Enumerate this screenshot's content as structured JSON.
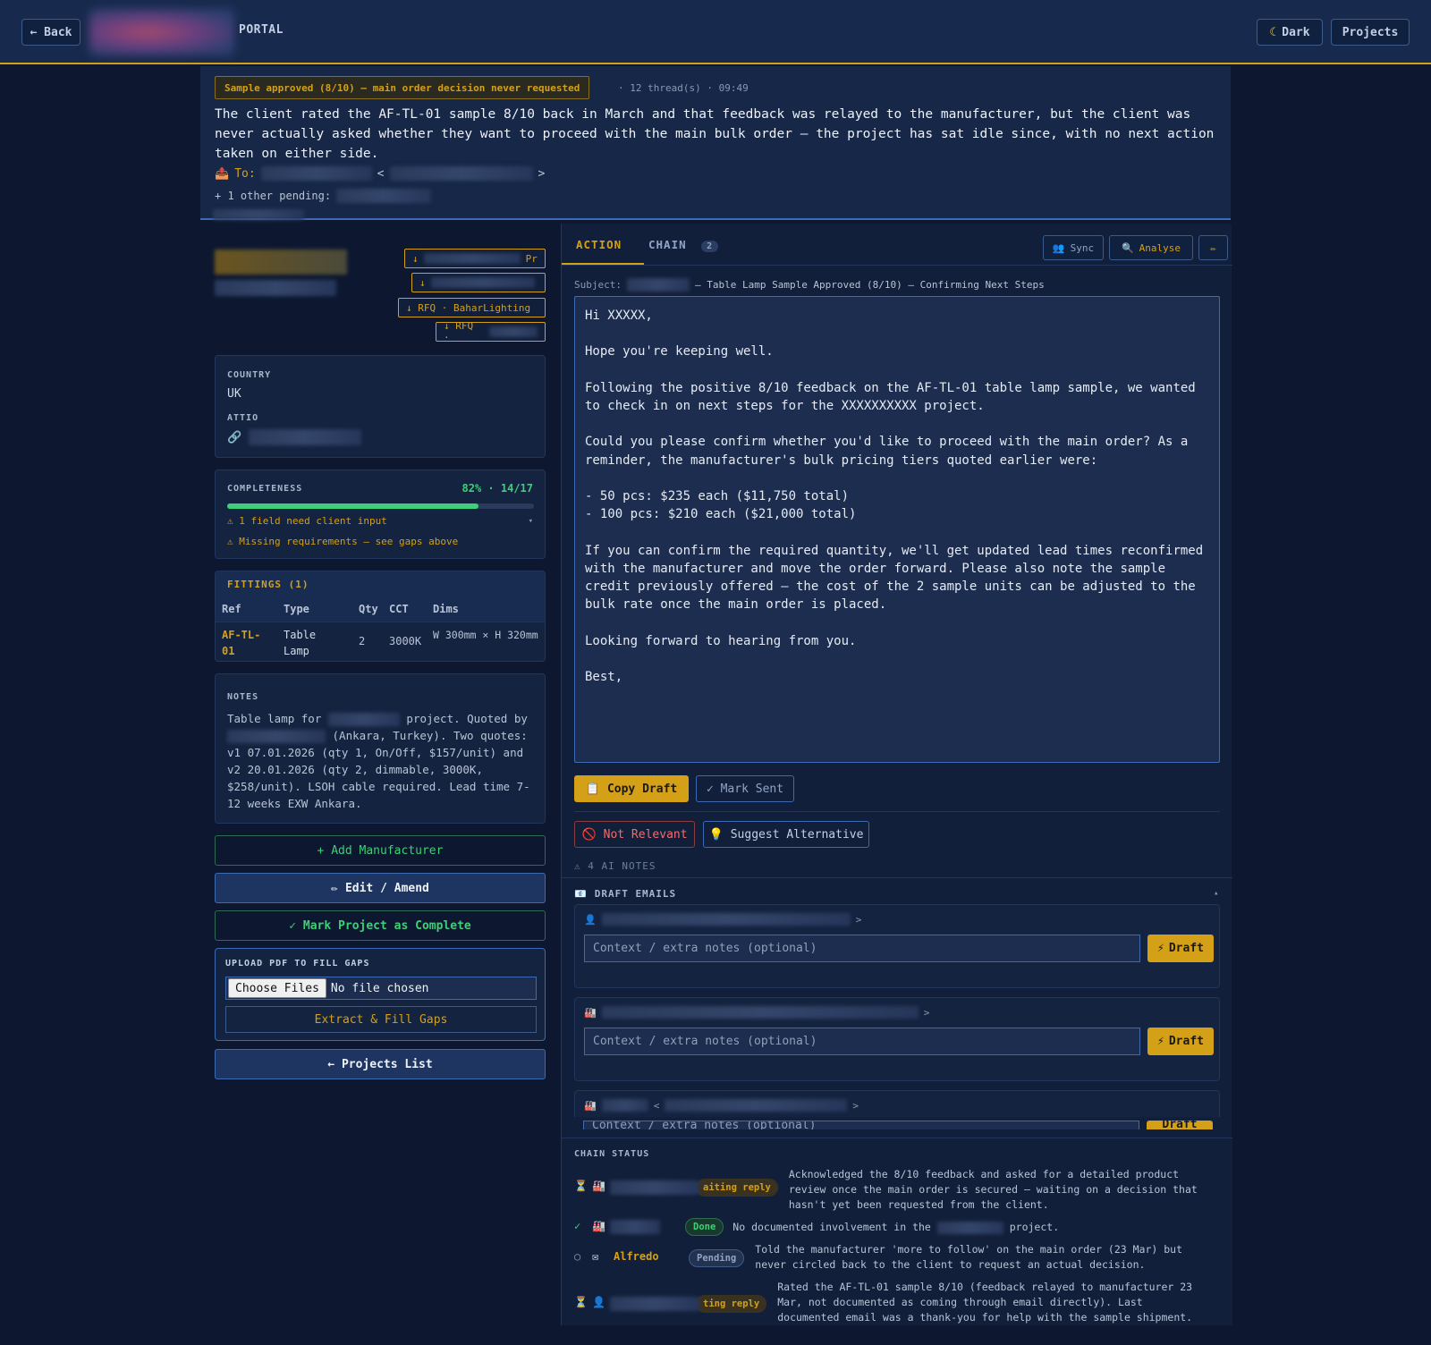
{
  "header": {
    "back_label": "← Back",
    "portal_label": "PORTAL",
    "theme_label": "Dark",
    "projects_label": "Projects"
  },
  "banner": {
    "alert": "Sample approved (8/10) — main order decision never requested",
    "meta": "· 12 thread(s) · 09:49",
    "summary": "The client rated the AF-TL-01 sample 8/10 back in March and that feedback was relayed to the manufacturer, but the client was never actually asked whether they want to proceed with the main bulk order — the project has sat idle since, with no next action taken on either side.",
    "to_label": "To:",
    "other_pending": "+ 1 other pending:"
  },
  "left": {
    "rfq_tags": [
      "↓",
      "Pr",
      "↓",
      "↓ RFQ · BaharLighting",
      "↓ RFQ ·"
    ],
    "country_label": "COUNTRY",
    "country_value": "UK",
    "attio_label": "ATTIO",
    "completeness_label": "COMPLETENESS",
    "completeness_value": "82% · 14/17",
    "completeness_fraction": 0.82,
    "warn_field": "⚠ 1 field need client input",
    "warn_missing": "⚠ Missing requirements — see gaps above",
    "fittings_title": "FITTINGS (1)",
    "fittings_headers": [
      "Ref",
      "Type",
      "Qty",
      "CCT",
      "Dims"
    ],
    "fittings_rows": [
      {
        "ref": "AF-TL-01",
        "type": "Table Lamp",
        "qty": "2",
        "cct": "3000K",
        "dims": "W 300mm × H 320mm"
      }
    ],
    "notes_label": "NOTES",
    "notes_p1": "Table lamp for",
    "notes_p2": "project. Quoted by",
    "notes_p3": "(Ankara, Turkey). Two quotes: v1 07.01.2026 (qty 1, On/Off, $157/unit) and v2 20.01.2026 (qty 2, dimmable, 3000K, $258/unit). LSOH cable required. Lead time 7-12 weeks EXW Ankara.",
    "add_manufacturer": "+ Add Manufacturer",
    "edit_amend": "Edit / Amend",
    "mark_complete": "✓ Mark Project as Complete",
    "upload_label": "UPLOAD PDF TO FILL GAPS",
    "choose_files": "Choose Files",
    "no_file": "No file chosen",
    "extract_fill": "Extract & Fill Gaps",
    "projects_list": "← Projects List"
  },
  "right": {
    "tab_action": "ACTION",
    "tab_chain": "CHAIN",
    "chain_count": "2",
    "sync_label": "Sync",
    "analyse_label": "Analyse",
    "subject_label": "Subject:",
    "subject_text": "— Table Lamp Sample Approved (8/10) — Confirming Next Steps",
    "draft_body": "Hi XXXXX,\n\nHope you're keeping well.\n\nFollowing the positive 8/10 feedback on the AF-TL-01 table lamp sample, we wanted to check in on next steps for the XXXXXXXXXX project.\n\nCould you please confirm whether you'd like to proceed with the main order? As a reminder, the manufacturer's bulk pricing tiers quoted earlier were:\n\n- 50 pcs: $235 each ($11,750 total)\n- 100 pcs: $210 each ($21,000 total)\n\nIf you can confirm the required quantity, we'll get updated lead times reconfirmed with the manufacturer and move the order forward. Please also note the sample credit previously offered — the cost of the 2 sample units can be adjusted to the bulk rate once the main order is placed.\n\nLooking forward to hearing from you.\n\nBest,",
    "copy_draft": "Copy Draft",
    "mark_sent": "✓ Mark Sent",
    "not_relevant": "Not Relevant",
    "suggest_alt": "Suggest Alternative",
    "ai_notes": "⚠ 4 AI NOTES",
    "draft_emails_label": "DRAFT EMAILS",
    "context_placeholder": "Context / extra notes (optional)",
    "draft_btn": "Draft",
    "chain_status_label": "CHAIN STATUS",
    "chain": [
      {
        "pill": "aiting reply",
        "desc": "Acknowledged the 8/10 feedback and asked for a detailed product review once the main order is secured — waiting on a decision that hasn't yet been requested from the client."
      },
      {
        "pill": "Done",
        "desc_a": "No documented involvement in the",
        "desc_b": "project."
      },
      {
        "name": "Alfredo",
        "pill": "Pending",
        "desc": "Told the manufacturer 'more to follow' on the main order (23 Mar) but never circled back to the client to request an actual decision."
      },
      {
        "pill": "ting reply",
        "desc": "Rated the AF-TL-01 sample 8/10 (feedback relayed to manufacturer 23 Mar, not documented as coming through email directly). Last documented email was a thank-you for help with the sample shipment."
      }
    ]
  }
}
